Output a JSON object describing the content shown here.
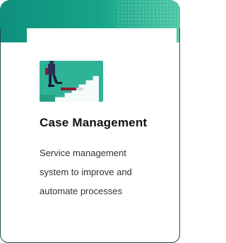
{
  "card": {
    "title": "Case Management",
    "description_lines": [
      "Service management",
      "system to improve and",
      "automate processes"
    ],
    "illustration_icon": "staircase-climb-illustration",
    "accent_color": "#16a589",
    "border_color": "#16524a"
  }
}
